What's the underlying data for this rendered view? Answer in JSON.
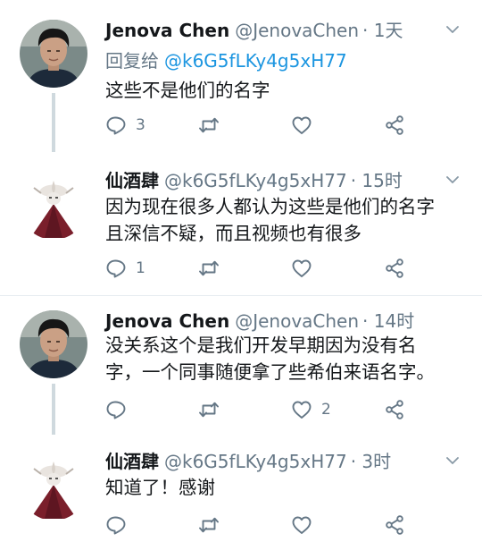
{
  "tweets": [
    {
      "author": "Jenova Chen",
      "handle": "@JenovaChen",
      "time": "· 1天",
      "reply_label": "回复给",
      "reply_handle": "@k6G5fLKy4g5xH77",
      "text_lines": [
        "这些不是他们的名字"
      ],
      "reply_count": "3",
      "like_count": ""
    },
    {
      "author": "仙酒肆",
      "handle": "@k6G5fLKy4g5xH77",
      "time": "· 15时",
      "text_lines": [
        "因为现在很多人都认为这些是他们的名字",
        "且深信不疑，而且视频也有很多"
      ],
      "reply_count": "1",
      "like_count": ""
    },
    {
      "author": "Jenova Chen",
      "handle": "@JenovaChen",
      "time": "· 14时",
      "text_lines": [
        "没关系这个是我们开发早期因为没有名",
        "字，一个同事随便拿了些希伯来语名字。"
      ],
      "reply_count": "",
      "like_count": "2"
    },
    {
      "author": "仙酒肆",
      "handle": "@k6G5fLKy4g5xH77",
      "time": "· 3时",
      "text_lines": [
        "知道了！感谢"
      ],
      "reply_count": "",
      "like_count": ""
    }
  ],
  "colors": {
    "text": "#14171a",
    "muted": "#657786",
    "link": "#1b95e0",
    "thread_line": "#cfd9de",
    "separator": "#e6ecf0"
  },
  "icons": [
    "reply-icon",
    "retweet-icon",
    "like-icon",
    "share-icon",
    "chevron-down-icon"
  ]
}
